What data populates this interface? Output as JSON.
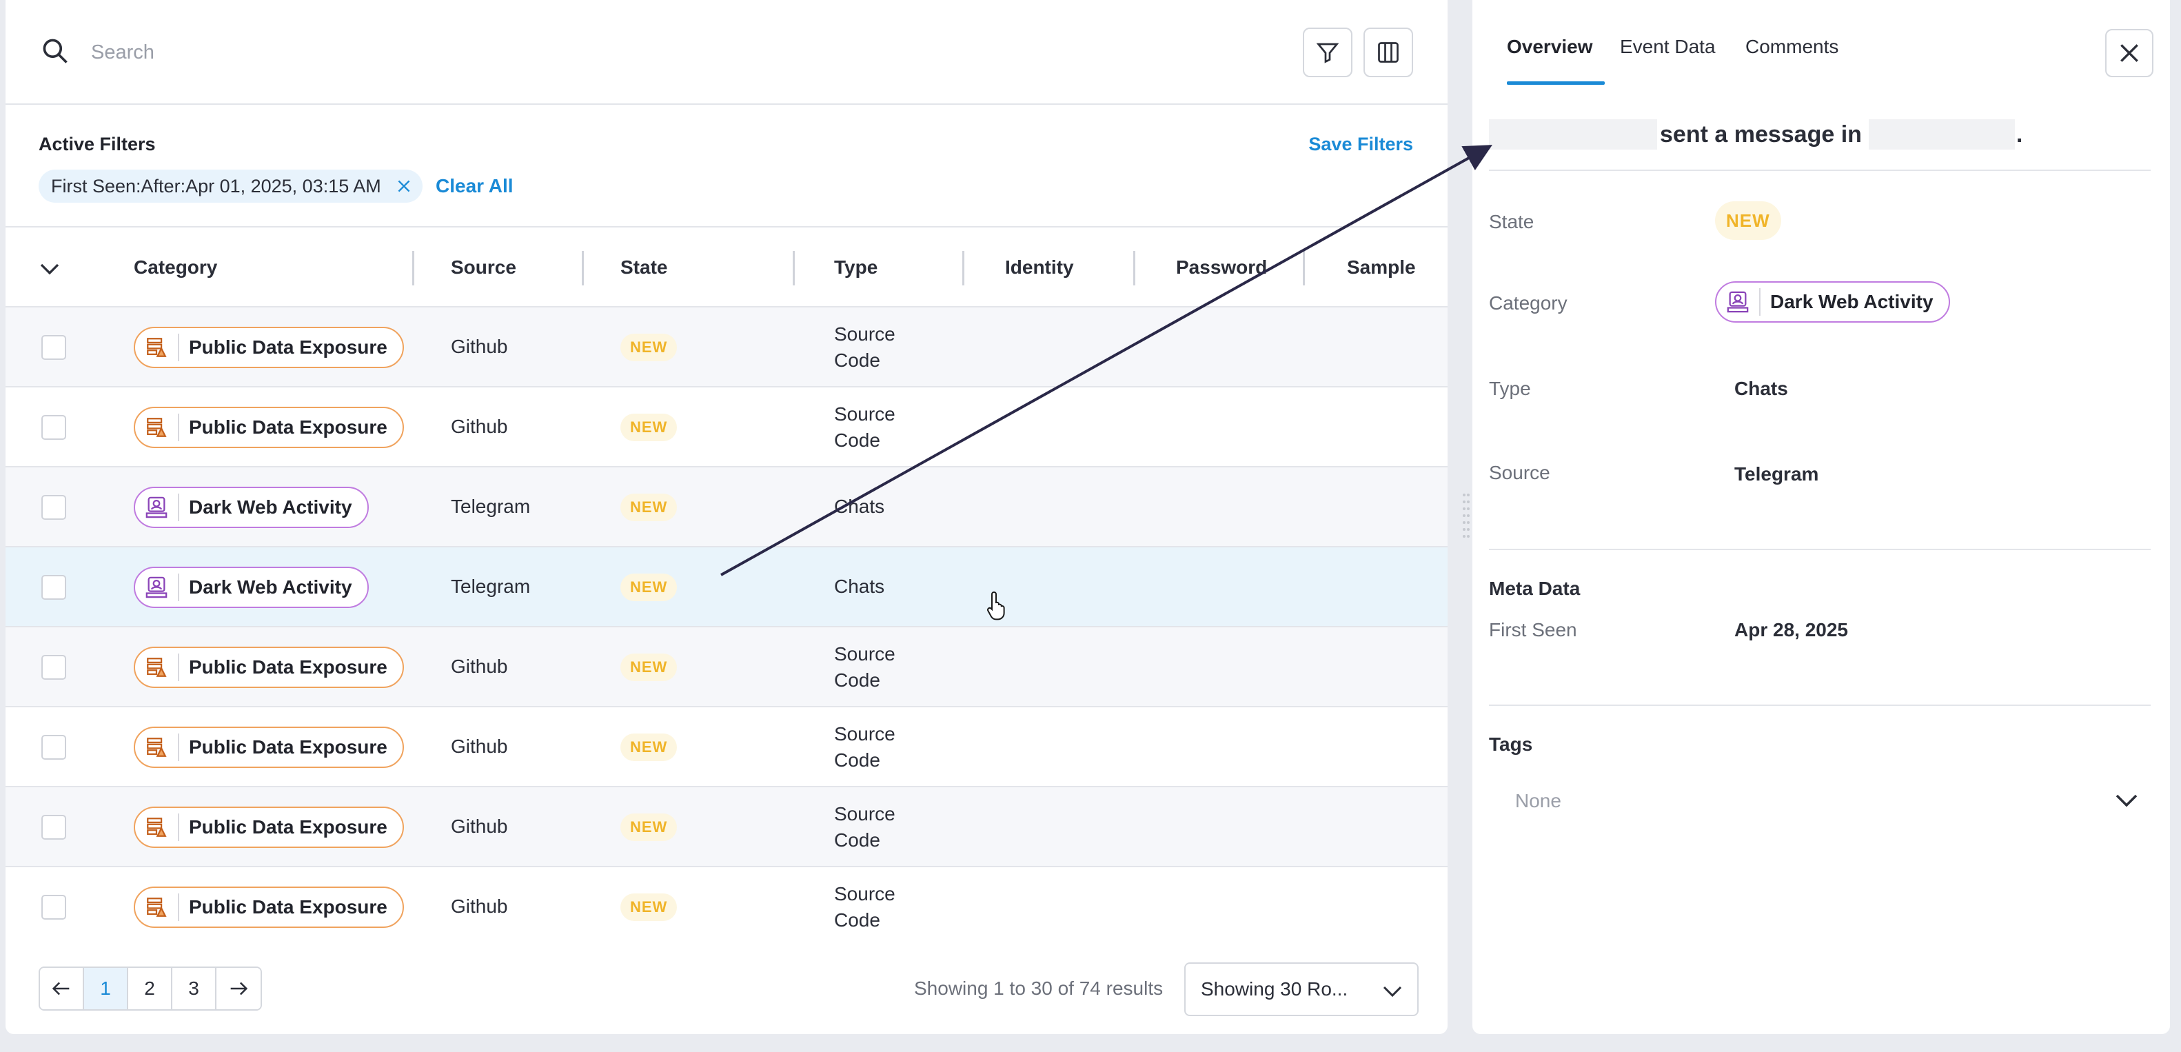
{
  "search": {
    "placeholder": "Search"
  },
  "filters": {
    "title": "Active Filters",
    "save_label": "Save Filters",
    "chip_text": "First Seen:After:Apr 01, 2025, 03:15 AM",
    "clear_all_label": "Clear All"
  },
  "table": {
    "columns": [
      "Category",
      "Source",
      "State",
      "Type",
      "Identity",
      "Password",
      "Sample"
    ],
    "rows": [
      {
        "category": "Public Data Exposure",
        "source": "Github",
        "state": "NEW",
        "type": "Source Code"
      },
      {
        "category": "Public Data Exposure",
        "source": "Github",
        "state": "NEW",
        "type": "Source Code"
      },
      {
        "category": "Dark Web Activity",
        "source": "Telegram",
        "state": "NEW",
        "type": "Chats"
      },
      {
        "category": "Dark Web Activity",
        "source": "Telegram",
        "state": "NEW",
        "type": "Chats"
      },
      {
        "category": "Public Data Exposure",
        "source": "Github",
        "state": "NEW",
        "type": "Source Code"
      },
      {
        "category": "Public Data Exposure",
        "source": "Github",
        "state": "NEW",
        "type": "Source Code"
      },
      {
        "category": "Public Data Exposure",
        "source": "Github",
        "state": "NEW",
        "type": "Source Code"
      },
      {
        "category": "Public Data Exposure",
        "source": "Github",
        "state": "NEW",
        "type": "Source Code"
      }
    ]
  },
  "pagination": {
    "pages": [
      "1",
      "2",
      "3"
    ],
    "current": "1",
    "results_text": "Showing 1 to 30 of 74 results",
    "rows_select": "Showing 30 Ro..."
  },
  "detail": {
    "tabs": [
      "Overview",
      "Event Data",
      "Comments"
    ],
    "headline_middle": "sent a message in",
    "headline_end": ".",
    "state_label": "State",
    "state_value": "NEW",
    "category_label": "Category",
    "category_value": "Dark Web Activity",
    "type_label": "Type",
    "type_value": "Chats",
    "source_label": "Source",
    "source_value": "Telegram",
    "meta_title": "Meta Data",
    "first_seen_label": "First Seen",
    "first_seen_value": "Apr 28, 2025",
    "tags_title": "Tags",
    "tags_value": "None"
  },
  "colors": {
    "accent": "#1a8ad6",
    "new_badge": "#f0b429",
    "public_exposure_border": "#f0a35e",
    "dark_web_border": "#c07ce0"
  }
}
